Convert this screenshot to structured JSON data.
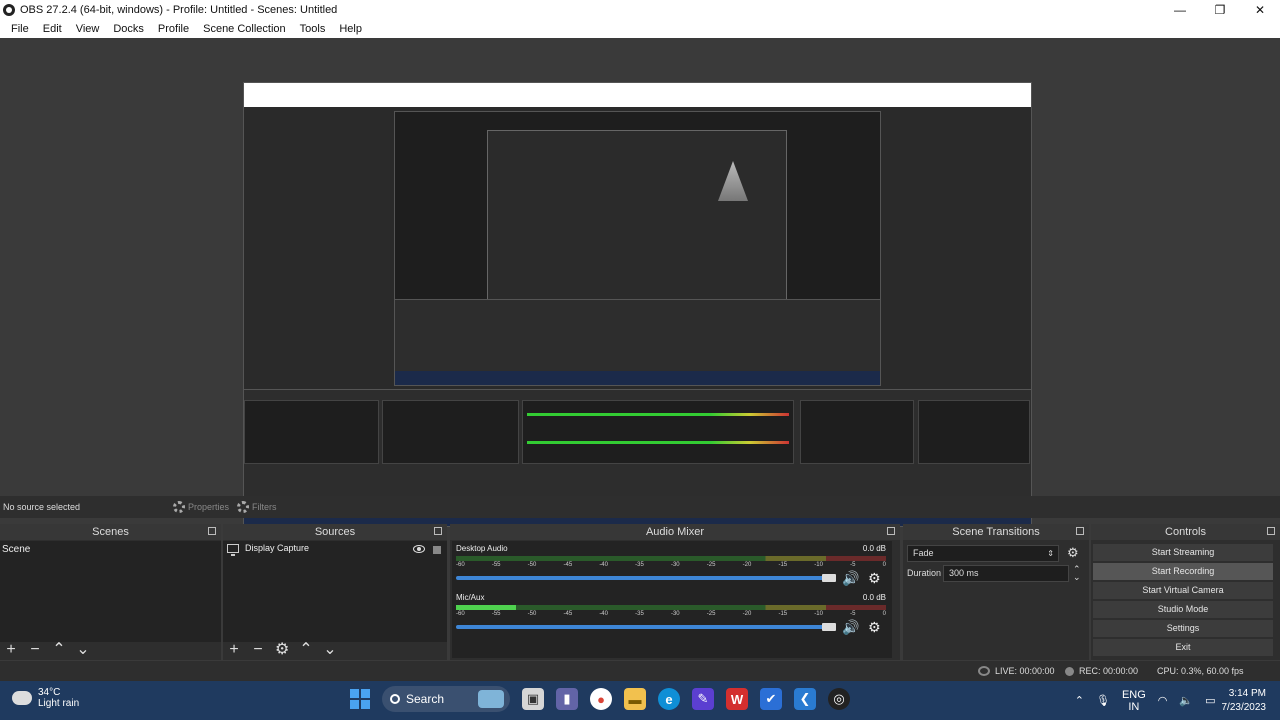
{
  "window": {
    "title": "OBS 27.2.4 (64-bit, windows) - Profile: Untitled - Scenes: Untitled",
    "minimize": "—",
    "maximize": "❐",
    "close": "✕"
  },
  "menu": [
    "File",
    "Edit",
    "View",
    "Docks",
    "Profile",
    "Scene Collection",
    "Tools",
    "Help"
  ],
  "source_strip": {
    "no_source": "No source selected",
    "properties": "Properties",
    "filters": "Filters"
  },
  "scenes": {
    "header": "Scenes",
    "items": [
      "Scene"
    ]
  },
  "sources": {
    "header": "Sources",
    "items": [
      "Display Capture"
    ]
  },
  "mixer": {
    "header": "Audio Mixer",
    "channels": [
      {
        "name": "Desktop Audio",
        "db": "0.0 dB",
        "level": 0.0,
        "volume": 1.0
      },
      {
        "name": "Mic/Aux",
        "db": "0.0 dB",
        "level": 0.14,
        "volume": 1.0
      }
    ],
    "ticks": [
      "-60",
      "-55",
      "-50",
      "-45",
      "-40",
      "-35",
      "-30",
      "-25",
      "-20",
      "-15",
      "-10",
      "-5",
      "0"
    ]
  },
  "transitions": {
    "header": "Scene Transitions",
    "selected": "Fade",
    "duration_label": "Duration",
    "duration_value": "300 ms"
  },
  "controls": {
    "header": "Controls",
    "buttons": [
      "Start Streaming",
      "Start Recording",
      "Start Virtual Camera",
      "Studio Mode",
      "Settings",
      "Exit"
    ]
  },
  "status": {
    "live": "LIVE: 00:00:00",
    "rec": "REC: 00:00:00",
    "cpu": "CPU: 0.3%, 60.00 fps"
  },
  "taskbar": {
    "temp": "34°C",
    "condition": "Light rain",
    "search": "Search",
    "lang_top": "ENG",
    "lang_bottom": "IN",
    "time": "3:14 PM",
    "date": "7/23/2023"
  },
  "colors": {
    "accent": "#3e86d6",
    "meter_green": "#4fd24f",
    "taskbar": "#1f3a5f"
  }
}
